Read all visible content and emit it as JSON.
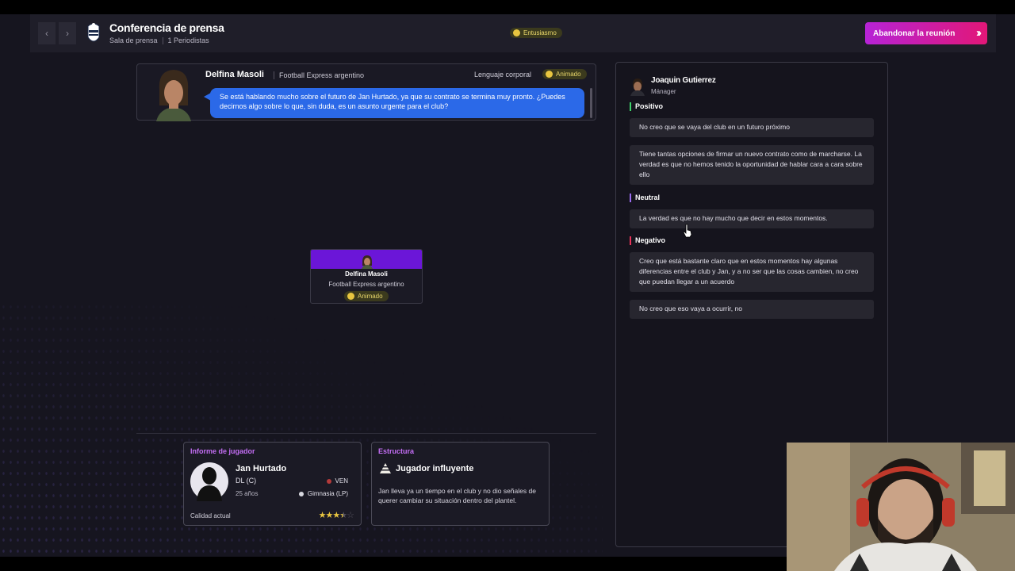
{
  "header": {
    "back": "‹",
    "forward": "›",
    "title": "Conferencia de prensa",
    "location": "Sala de prensa",
    "journalists": "1 Periodistas",
    "mood": "Entusiasmo",
    "leave_button": "Abandonar la reunión"
  },
  "question": {
    "journalist_name": "Delfina Masoli",
    "outlet": "Football Express argentino",
    "body_language_label": "Lenguaje corporal",
    "body_language_value": "Animado",
    "text": "Se está hablando mucho sobre el futuro de Jan Hurtado, ya que su contrato se termina muy pronto. ¿Puedes decirnos algo sobre lo que, sin duda, es un asunto urgente para el club?"
  },
  "journalist_card": {
    "name": "Delfina Masoli",
    "outlet": "Football Express argentino",
    "mood": "Animado"
  },
  "player_report": {
    "title": "Informe de jugador",
    "name": "Jan Hurtado",
    "position": "DL (C)",
    "age": "25 años",
    "nationality": "VEN",
    "club": "Gimnasia (LP)",
    "quality_label": "Calidad actual",
    "stars": 3.5,
    "stars_text": "★★★",
    "half_star": "★",
    "empty_star": "☆"
  },
  "structure": {
    "title": "Estructura",
    "heading": "Jugador influyente",
    "body": "Jan lleva ya un tiempo en el club y no dio señales de querer cambiar su situación dentro del plantel."
  },
  "answers": {
    "manager_name": "Joaquin Gutierrez",
    "manager_role": "Mánager",
    "positive_label": "Positivo",
    "positive": [
      "No creo que se vaya del club en un futuro próximo",
      "Tiene tantas opciones de firmar un nuevo contrato como de marcharse. La verdad es que no hemos tenido la oportunidad de hablar cara a cara sobre ello"
    ],
    "neutral_label": "Neutral",
    "neutral": [
      "La verdad es que no hay mucho que decir en estos momentos."
    ],
    "negative_label": "Negativo",
    "negative": [
      "Creo que está bastante claro que en estos momentos hay algunas diferencias entre el club y Jan, y a no ser que las cosas cambien, no creo que puedan llegar a un acuerdo",
      "No creo que eso vaya a ocurrir, no"
    ]
  },
  "colors": {
    "accent_purple": "#6b16d8",
    "bubble_blue": "#2b69e8",
    "positive": "#3dd16a",
    "neutral": "#9b6cf0",
    "negative": "#e8335a",
    "leave_gradient_start": "#b623d6",
    "leave_gradient_end": "#e21777"
  }
}
